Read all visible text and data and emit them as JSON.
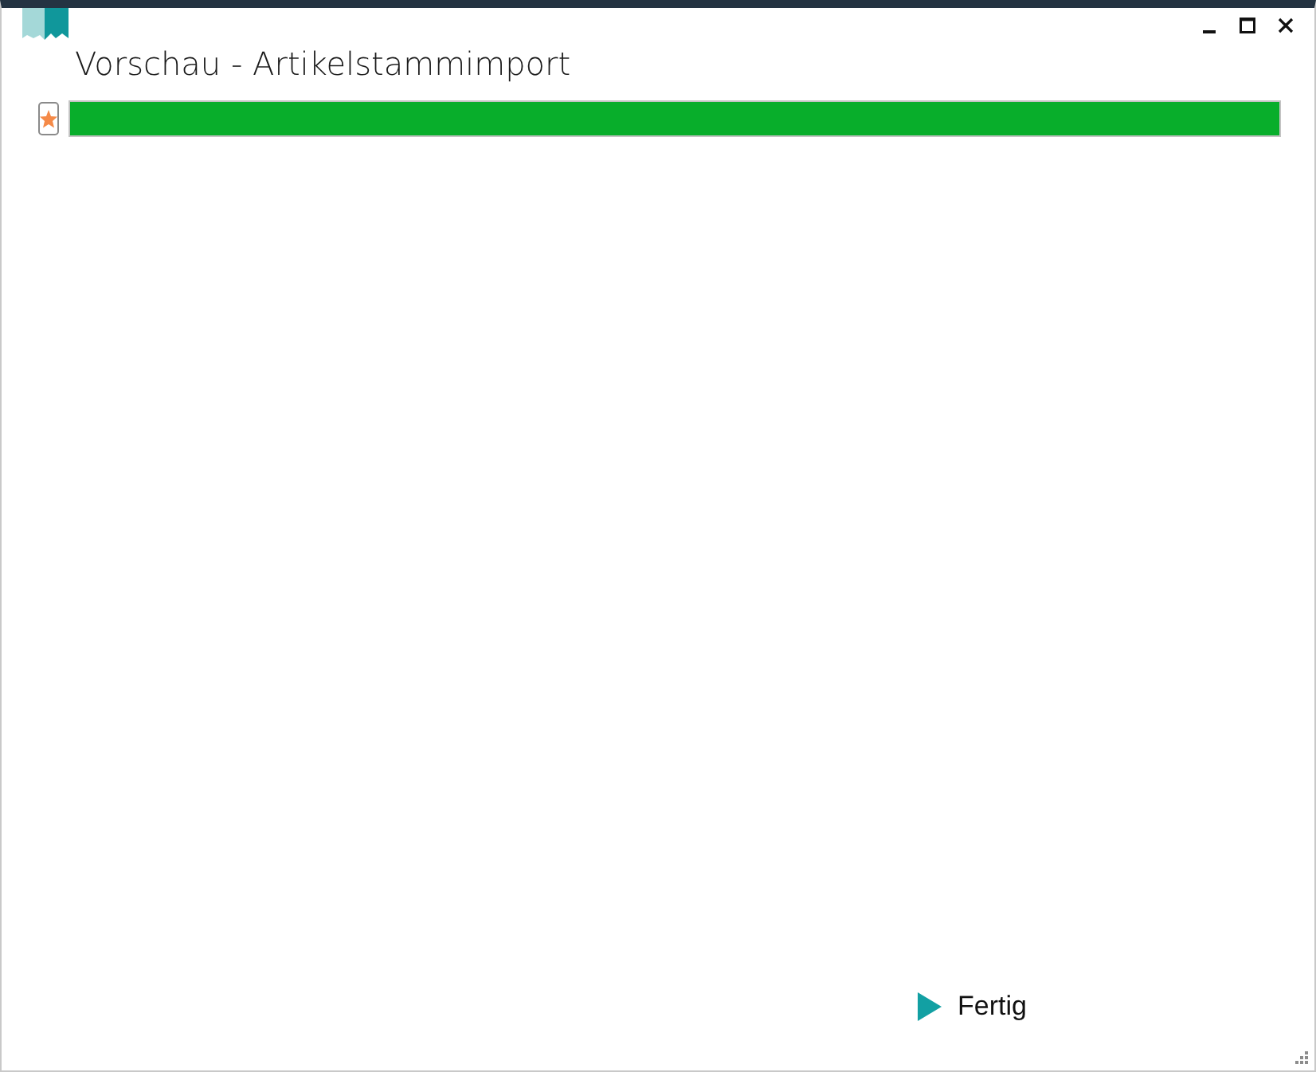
{
  "window": {
    "title": "Vorschau - Artikelstammimport"
  },
  "progress": {
    "level": 1
  },
  "footer": {
    "button": "Fertig"
  }
}
